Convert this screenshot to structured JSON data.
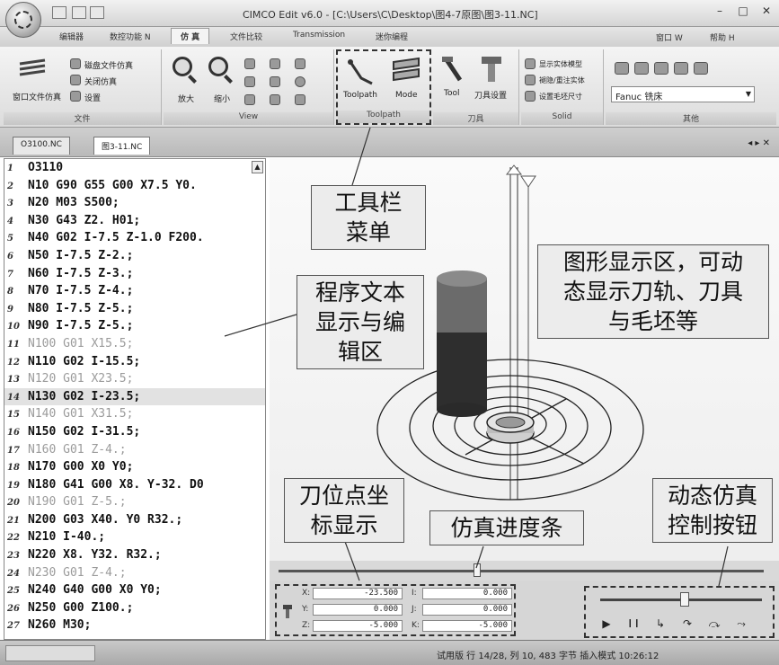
{
  "titlebar": {
    "title": "CIMCO Edit v6.0 - [C:\\Users\\C\\Desktop\\图4-7原图\\图3-11.NC]",
    "minimize": "–",
    "maximize": "□",
    "close": "✕"
  },
  "ribbon_tabs": [
    "编辑器",
    "数控功能 N",
    "仿 真",
    "文件比较",
    "Transmission",
    "迷你编程"
  ],
  "ribbon_menus": {
    "window": "窗口 W",
    "help": "帮助 H"
  },
  "ribbon": {
    "file_group": {
      "label": "文件",
      "big_button": "窗口文件仿真",
      "items": [
        "磁盘文件仿真",
        "关闭仿真",
        "设置"
      ]
    },
    "view_group": {
      "label": "View",
      "zoom_in": "放大",
      "zoom_out": "缩小"
    },
    "toolpath_group": {
      "label": "Toolpath",
      "toolpath": "Toolpath",
      "mode": "Mode"
    },
    "tool_group": {
      "label": "刀具",
      "tool": "Tool",
      "tool_settings": "刀具设置"
    },
    "solid_group": {
      "label": "Solid",
      "items": [
        "显示实体模型",
        "褪隐/重注实体",
        "设置毛坯尺寸"
      ]
    },
    "other_group": {
      "label": "其他",
      "machine": "Fanuc  铣床"
    }
  },
  "doc_tabs": [
    "O3100.NC",
    "图3-11.NC"
  ],
  "doc_tabs_close": "◂ ▸ ✕",
  "code_lines": [
    {
      "n": "1",
      "text": "O3110",
      "style": "normal"
    },
    {
      "n": "2",
      "text": "N10 G90 G55 G00 X7.5 Y0.",
      "style": "normal"
    },
    {
      "n": "3",
      "text": "N20 M03 S500;",
      "style": "normal"
    },
    {
      "n": "4",
      "text": "N30 G43 Z2. H01;",
      "style": "normal"
    },
    {
      "n": "5",
      "text": "N40 G02 I-7.5 Z-1.0 F200.",
      "style": "normal"
    },
    {
      "n": "6",
      "text": "N50 I-7.5 Z-2.;",
      "style": "normal"
    },
    {
      "n": "7",
      "text": "N60 I-7.5 Z-3.;",
      "style": "normal"
    },
    {
      "n": "8",
      "text": "N70 I-7.5 Z-4.;",
      "style": "normal"
    },
    {
      "n": "9",
      "text": "N80 I-7.5 Z-5.;",
      "style": "normal"
    },
    {
      "n": "10",
      "text": "N90 I-7.5 Z-5.;",
      "style": "normal"
    },
    {
      "n": "11",
      "text": "N100 G01 X15.5;",
      "style": "dim"
    },
    {
      "n": "12",
      "text": "N110 G02 I-15.5;",
      "style": "normal"
    },
    {
      "n": "13",
      "text": "N120 G01 X23.5;",
      "style": "dim"
    },
    {
      "n": "14",
      "text": "N130 G02 I-23.5;",
      "style": "highlight"
    },
    {
      "n": "15",
      "text": "N140 G01 X31.5;",
      "style": "dim"
    },
    {
      "n": "16",
      "text": "N150 G02 I-31.5;",
      "style": "normal"
    },
    {
      "n": "17",
      "text": "N160 G01 Z-4.;",
      "style": "dim"
    },
    {
      "n": "18",
      "text": "N170 G00 X0 Y0;",
      "style": "normal"
    },
    {
      "n": "19",
      "text": "N180 G41 G00 X8. Y-32. D0",
      "style": "normal"
    },
    {
      "n": "20",
      "text": "N190 G01 Z-5.;",
      "style": "dim"
    },
    {
      "n": "21",
      "text": "N200 G03 X40. Y0 R32.;",
      "style": "normal"
    },
    {
      "n": "22",
      "text": "N210 I-40.;",
      "style": "normal"
    },
    {
      "n": "23",
      "text": "N220 X8. Y32. R32.;",
      "style": "normal"
    },
    {
      "n": "24",
      "text": "N230 G01 Z-4.;",
      "style": "dim"
    },
    {
      "n": "25",
      "text": "N240 G40 G00 X0 Y0;",
      "style": "normal"
    },
    {
      "n": "26",
      "text": "N250 G00 Z100.;",
      "style": "normal"
    },
    {
      "n": "27",
      "text": "N260 M30;",
      "style": "normal"
    }
  ],
  "coords": {
    "x_label": "X:",
    "y_label": "Y:",
    "z_label": "Z:",
    "i_label": "I:",
    "j_label": "J:",
    "k_label": "K:",
    "x": "-23.500",
    "y": "0.000",
    "z": "-5.000",
    "i": "0.000",
    "j": "0.000",
    "k": "-5.000"
  },
  "progress": {
    "sim_fraction": 0.41,
    "speed_fraction": 0.52
  },
  "controls": [
    "▶",
    "❙❙",
    "↳",
    "↷",
    "⤼",
    "⤳"
  ],
  "status": {
    "text": "试用版  行 14/28,  列 10,  483 字节    插入模式  10:26:12"
  },
  "callouts": {
    "toolbar": [
      "工具栏",
      "菜单"
    ],
    "editor": [
      "程序文本",
      "显示与编",
      "辑区"
    ],
    "graphics": [
      "图形显示区，可动",
      "态显示刀轨、刀具",
      "与毛坯等"
    ],
    "coords": [
      "刀位点坐",
      "标显示"
    ],
    "progress": [
      "仿真进度条"
    ],
    "controls": [
      "动态仿真",
      "控制按钮"
    ]
  },
  "colors": {
    "background": "#ffffff",
    "ribbon": "#e2e2e2",
    "callout_bg": "#ececec",
    "highlight_line": "#e2e2e2"
  }
}
